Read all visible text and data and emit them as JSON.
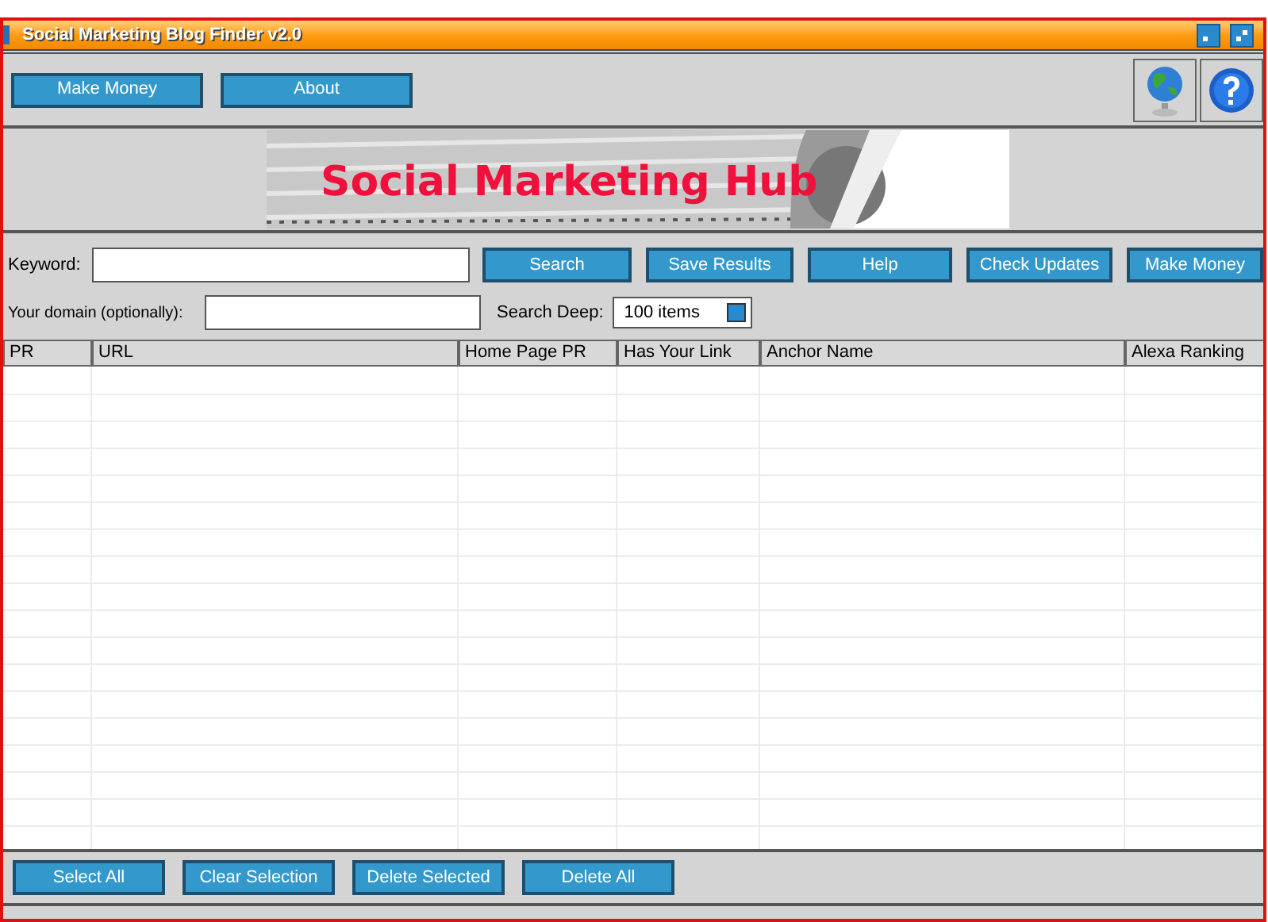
{
  "window": {
    "title": "Social Marketing Blog Finder v2.0"
  },
  "toolbar": {
    "buttons": [
      "Make Money",
      "About"
    ]
  },
  "banner": {
    "title": "Social Marketing Hub"
  },
  "search": {
    "keyword_label": "Keyword:",
    "domain_label": "Your domain (optionally):",
    "deep_label": "Search Deep:",
    "deep_value": "100 items",
    "buttons": [
      "Search",
      "Save Results",
      "Help",
      "Check Updates",
      "Make Money"
    ]
  },
  "table": {
    "columns": [
      "PR",
      "URL",
      "Home Page PR",
      "Has Your Link",
      "Anchor Name",
      "Alexa Ranking"
    ]
  },
  "bottom_buttons": [
    "Select All",
    "Clear Selection",
    "Delete Selected",
    "Delete All"
  ]
}
